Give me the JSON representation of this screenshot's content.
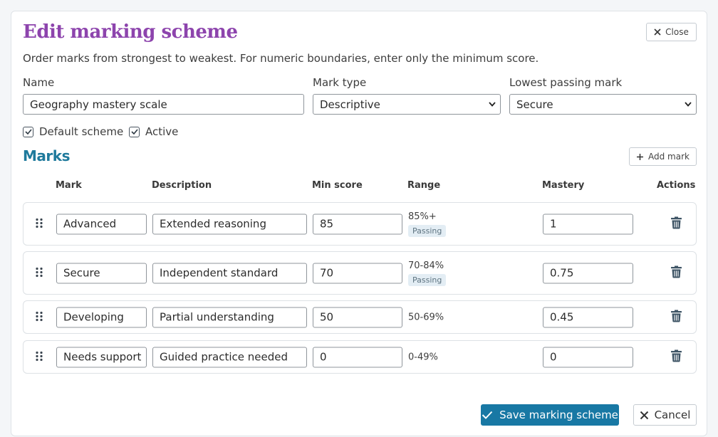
{
  "dialog": {
    "title": "Edit marking scheme",
    "subtitle": "Order marks from strongest to weakest. For numeric boundaries, enter only the minimum score.",
    "close_label": "Close"
  },
  "form": {
    "name_label": "Name",
    "name_value": "Geography mastery scale",
    "mark_type_label": "Mark type",
    "mark_type_value": "Descriptive",
    "lowest_passing_label": "Lowest passing mark",
    "lowest_passing_value": "Secure",
    "default_label": "Default scheme",
    "default_checked": true,
    "active_label": "Active",
    "active_checked": true
  },
  "marks": {
    "heading": "Marks",
    "add_label": "Add mark",
    "columns": {
      "mark": "Mark",
      "description": "Description",
      "min_score": "Min score",
      "range": "Range",
      "mastery": "Mastery",
      "actions": "Actions"
    },
    "rows": [
      {
        "mark": "Advanced",
        "description": "Extended reasoning",
        "min_score": "85",
        "range": "85%+",
        "badge": "Passing",
        "mastery": "1"
      },
      {
        "mark": "Secure",
        "description": "Independent standard",
        "min_score": "70",
        "range": "70-84%",
        "badge": "Passing",
        "mastery": "0.75"
      },
      {
        "mark": "Developing",
        "description": "Partial understanding",
        "min_score": "50",
        "range": "50-69%",
        "badge": "",
        "mastery": "0.45"
      },
      {
        "mark": "Needs support",
        "description": "Guided practice needed",
        "min_score": "0",
        "range": "0-49%",
        "badge": "",
        "mastery": "0"
      }
    ]
  },
  "footer": {
    "save_label": "Save marking scheme",
    "cancel_label": "Cancel"
  },
  "icons": {
    "close": "close-icon",
    "chevron": "chevron-down-icon",
    "checkbox": "checkmark-icon",
    "add": "plus-icon",
    "drag": "drag-handle-icon",
    "delete": "trash-icon",
    "save": "checkmark-icon",
    "cancel": "close-icon"
  },
  "colors": {
    "title": "#8d44ad",
    "section_heading": "#1f7a9c",
    "primary_button": "#1878a4",
    "badge_bg": "#e3edf4",
    "trash": "#3f5566"
  }
}
